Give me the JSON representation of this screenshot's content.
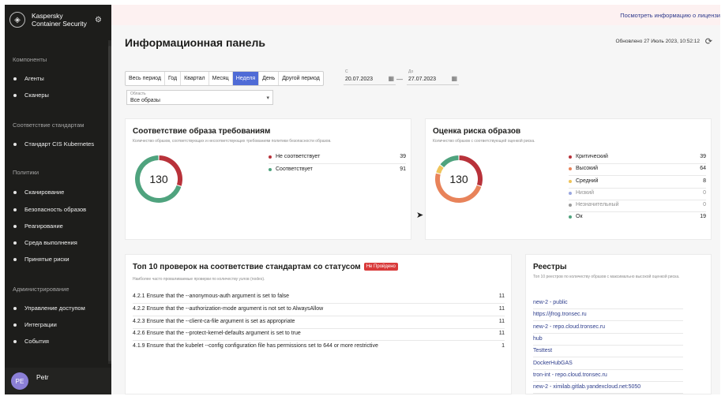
{
  "sidebar": {
    "brand_line1": "Kaspersky",
    "brand_line2": "Container Security",
    "sections": [
      {
        "title": "Компоненты",
        "items": [
          "Агенты",
          "Сканеры"
        ]
      },
      {
        "title": "Соответствие стандартам",
        "items": [
          "Стандарт CIS Kubernetes"
        ]
      },
      {
        "title": "Политики",
        "items": [
          "Сканирование",
          "Безопасность образов",
          "Реагирование",
          "Среда выполнения",
          "Принятые риски"
        ]
      },
      {
        "title": "Администрирование",
        "items": [
          "Управление доступом",
          "Интеграции",
          "События"
        ]
      }
    ],
    "user": {
      "initials": "PE",
      "name": "Petr"
    }
  },
  "banner": {
    "link": "Посмотреть информацию о лицензи"
  },
  "header": {
    "title": "Информационная панель",
    "updated": "Обновлено 27 Июль 2023, 10:52:12"
  },
  "filters": {
    "periods": [
      "Весь период",
      "Год",
      "Квартал",
      "Месяц",
      "Неделя",
      "День",
      "Другой период"
    ],
    "active_period": "Неделя",
    "from_label": "С",
    "from_value": "20.07.2023",
    "to_label": "До",
    "to_value": "27.07.2023",
    "dash": "—",
    "scope_label": "Область",
    "scope_value": "Все образы"
  },
  "compliance": {
    "title": "Соответствие образа требованиям",
    "subtitle": "Количество образов, соответствующих и несоответствующих требованиям политики безопасности образов.",
    "total": "130",
    "rows": [
      {
        "label": "Не соответствует",
        "value": "39",
        "color": "#b8323a"
      },
      {
        "label": "Соответствует",
        "value": "91",
        "color": "#4fa37e"
      }
    ]
  },
  "risk": {
    "title": "Оценка риска образов",
    "subtitle": "Количество образов с соответствующей оценкой риска.",
    "total": "130",
    "rows": [
      {
        "label": "Критический",
        "value": "39",
        "color": "#b8323a",
        "muted": false
      },
      {
        "label": "Высокий",
        "value": "64",
        "color": "#e8835a",
        "muted": false
      },
      {
        "label": "Средний",
        "value": "8",
        "color": "#efc45a",
        "muted": false
      },
      {
        "label": "Низкий",
        "value": "0",
        "color": "#9aa7e0",
        "muted": true
      },
      {
        "label": "Незначительный",
        "value": "0",
        "color": "#9a9a9a",
        "muted": true
      },
      {
        "label": "Ок",
        "value": "19",
        "color": "#4fa37e",
        "muted": false
      }
    ]
  },
  "checks": {
    "title": "Топ 10 проверок на соответствие стандартам со статусом",
    "badge": "Не Пройдено",
    "subtitle": "Наиболее часто проваливаемые проверки по количеству узлов (nodes).",
    "rows": [
      {
        "text": "4.2.1 Ensure that the --anonymous-auth argument is set to false",
        "count": "11"
      },
      {
        "text": "4.2.2 Ensure that the --authorization-mode argument is not set to AlwaysAllow",
        "count": "11"
      },
      {
        "text": "4.2.3 Ensure that the --client-ca-file argument is set as appropriate",
        "count": "11"
      },
      {
        "text": "4.2.6 Ensure that the --protect-kernel-defaults argument is set to true",
        "count": "11"
      },
      {
        "text": "4.1.9 Ensure that the kubelet --config configuration file has permissions set to 644 or more restrictive",
        "count": "1"
      }
    ]
  },
  "registries": {
    "title": "Реестры",
    "subtitle": "Топ 10 реестров по количеству образов с максимально высокой оценкой риска.",
    "items": [
      "new-2 - public",
      "https://jfrog.tronsec.ru",
      "new-2 - repo.cloud.tronsec.ru",
      "hub",
      "Testtest",
      "DockerHubGAS",
      "tron-int - repo.cloud.tronsec.ru",
      "new-2 - ximilab.gitlab.yandexcloud.net:5050"
    ]
  }
}
